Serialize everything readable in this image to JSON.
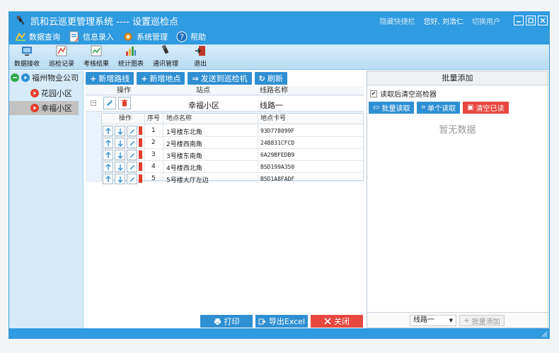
{
  "window": {
    "title": "凯和云巡更管理系统 ---- 设置巡检点",
    "shortcut_bar": "隐藏快捷栏",
    "greeting": "您好, 刘浩仁",
    "switch_user": "切换用户"
  },
  "menu": [
    {
      "label": "数据查询",
      "icon": "data-query-icon"
    },
    {
      "label": "信息录入",
      "icon": "info-entry-icon"
    },
    {
      "label": "系统管理",
      "icon": "system-gear-icon"
    },
    {
      "label": "帮助",
      "icon": "help-icon"
    }
  ],
  "toolbar": [
    {
      "label": "数据接收",
      "icon": "data-receive-icon"
    },
    {
      "label": "巡检记录",
      "icon": "patrol-record-icon"
    },
    {
      "label": "考核结果",
      "icon": "assessment-icon"
    },
    {
      "label": "统计图表",
      "icon": "bar-chart-icon"
    },
    {
      "label": "通讯管理",
      "icon": "communication-icon"
    },
    {
      "label": "退出",
      "icon": "exit-icon"
    }
  ],
  "tree": {
    "root": "福州物业公司",
    "children": [
      "花园小区",
      "幸福小区"
    ],
    "selected": "幸福小区"
  },
  "actions": {
    "add_route": "新增路线",
    "add_point": "新增地点",
    "send": "发送到巡检机",
    "refresh": "刷新"
  },
  "route_grid": {
    "headers": {
      "ops": "操作",
      "site": "站点",
      "route": "线路名称"
    },
    "row": {
      "site": "幸福小区",
      "route": "线路一"
    }
  },
  "point_grid": {
    "headers": {
      "ops": "操作",
      "index": "序号",
      "name": "地点名称",
      "card": "地点卡号"
    },
    "rows": [
      {
        "index": "1",
        "name": "1号楼东北角",
        "card": "93D778099F"
      },
      {
        "index": "2",
        "name": "2号楼西南角",
        "card": "24B831CFCD"
      },
      {
        "index": "3",
        "name": "3号楼东南角",
        "card": "6A29BFEDB9"
      },
      {
        "index": "4",
        "name": "4号楼西北角",
        "card": "B5D199A350"
      },
      {
        "index": "5",
        "name": "5号楼大厅左边",
        "card": "B5D1A8FADF"
      }
    ]
  },
  "bottom": {
    "print": "打印",
    "export": "导出Excel",
    "close": "关闭"
  },
  "batch_panel": {
    "title": "批量添加",
    "clear_after_read": "读取后清空巡检器",
    "clear_checked": true,
    "batch_read": "批量读取",
    "single_read": "单个读取",
    "clear_read": "清空已读",
    "empty_text": "暂无数据",
    "route_select": "线路一",
    "batch_add": "批量添加"
  },
  "colors": {
    "titlebar": "#2f9be0",
    "primary_button": "#2f8fd3",
    "danger_button": "#e6473f",
    "tree_green": "#2eaa4a",
    "tree_red": "#e23d2b"
  }
}
